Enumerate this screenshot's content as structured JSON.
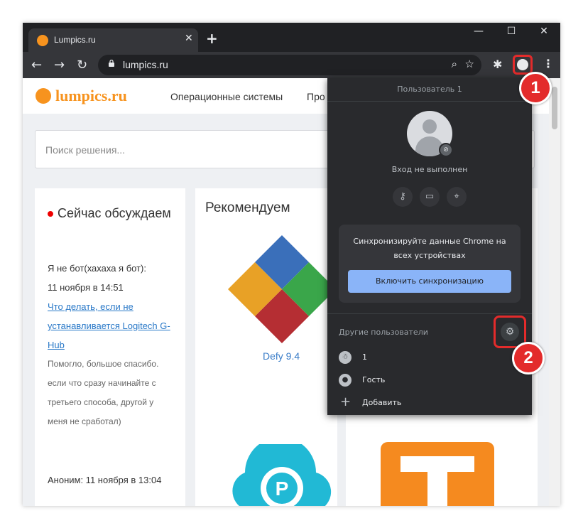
{
  "browser": {
    "tab_title": "Lumpics.ru",
    "tab_close": "✕",
    "new_tab": "+",
    "url": "lumpics.ru",
    "window_controls": {
      "minimize": "—",
      "maximize": "☐",
      "close": "✕"
    }
  },
  "site": {
    "logo": "lumpics.ru",
    "nav": [
      "Операционные системы",
      "Про"
    ],
    "search_placeholder": "Поиск решения...",
    "discussion": {
      "title": "Сейчас обсуждаем",
      "comments": [
        {
          "author_line": "Я не бот(хахаха я бот):",
          "date": "11 ноября в 14:51",
          "link": "Что делать, если не устанавливается Logitech G-Hub",
          "text": "Помогло, большое спасибо. если что сразу начинайте с третьего способа, другой у меня не сработал)"
        },
        {
          "author_line": "Аноним: 11 ноября в 13:04"
        }
      ]
    },
    "recommend": {
      "title": "Рекомендуем",
      "item_caption": "Defy 9.4"
    }
  },
  "profile_popup": {
    "user_label": "Пользователь 1",
    "signin_status": "Вход не выполнен",
    "sync_text": "Синхронизируйте данные Chrome на всех устройствах",
    "sync_button": "Включить синхронизацию",
    "other_users_label": "Другие пользователи",
    "users": [
      {
        "name": "1"
      },
      {
        "name": "Гость"
      },
      {
        "name": "Добавить"
      }
    ]
  },
  "callouts": [
    "1",
    "2"
  ],
  "colors": {
    "accent_red": "#e32b2b",
    "sync_blue": "#8ab4f8",
    "brand_orange": "#f7931e",
    "popup_bg": "#292a2d"
  }
}
